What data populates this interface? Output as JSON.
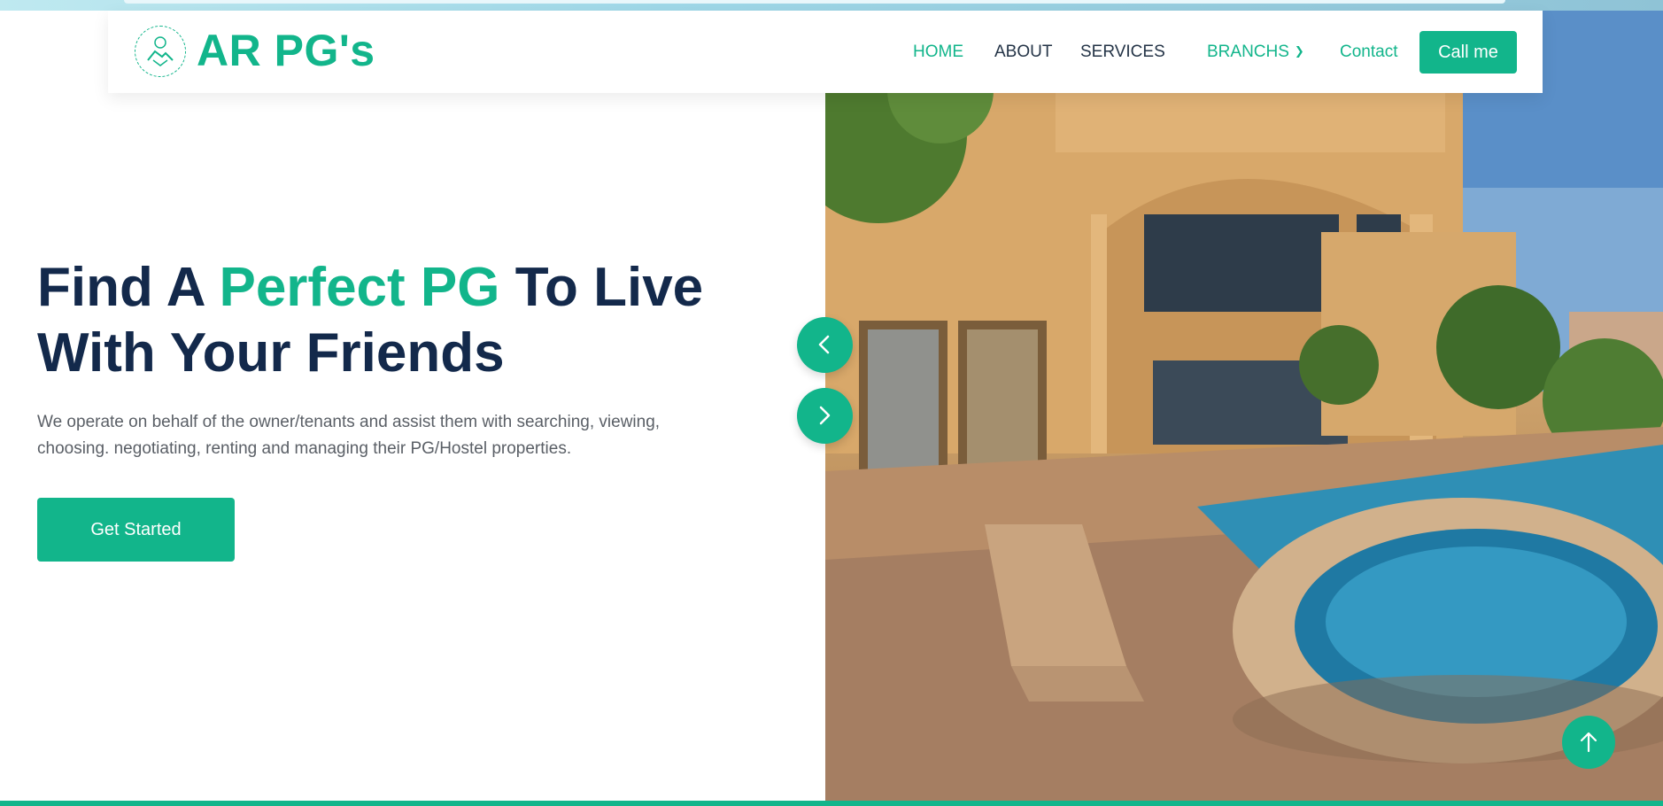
{
  "brand": {
    "name": "AR PG's",
    "color": "#12b58b"
  },
  "nav": {
    "items": [
      {
        "label": "HOME",
        "active": true
      },
      {
        "label": "ABOUT"
      },
      {
        "label": "SERVICES"
      },
      {
        "label": "BRANCHS",
        "dropdown": true
      },
      {
        "label": "Contact"
      }
    ],
    "cta": "Call me"
  },
  "hero": {
    "title_part1": "Find A ",
    "title_accent": "Perfect PG",
    "title_part2": " To Live",
    "title_line2": "With Your Friends",
    "description": "We operate on behalf of the owner/tenants and assist them with searching, viewing, choosing. negotiating, renting and managing their PG/Hostel properties.",
    "button": "Get Started"
  },
  "icons": {
    "logo": "handshake-icon",
    "prev": "chevron-left-icon",
    "next": "chevron-right-icon",
    "dropdown": "chevron-down-icon",
    "back_to_top": "arrow-up-icon"
  }
}
